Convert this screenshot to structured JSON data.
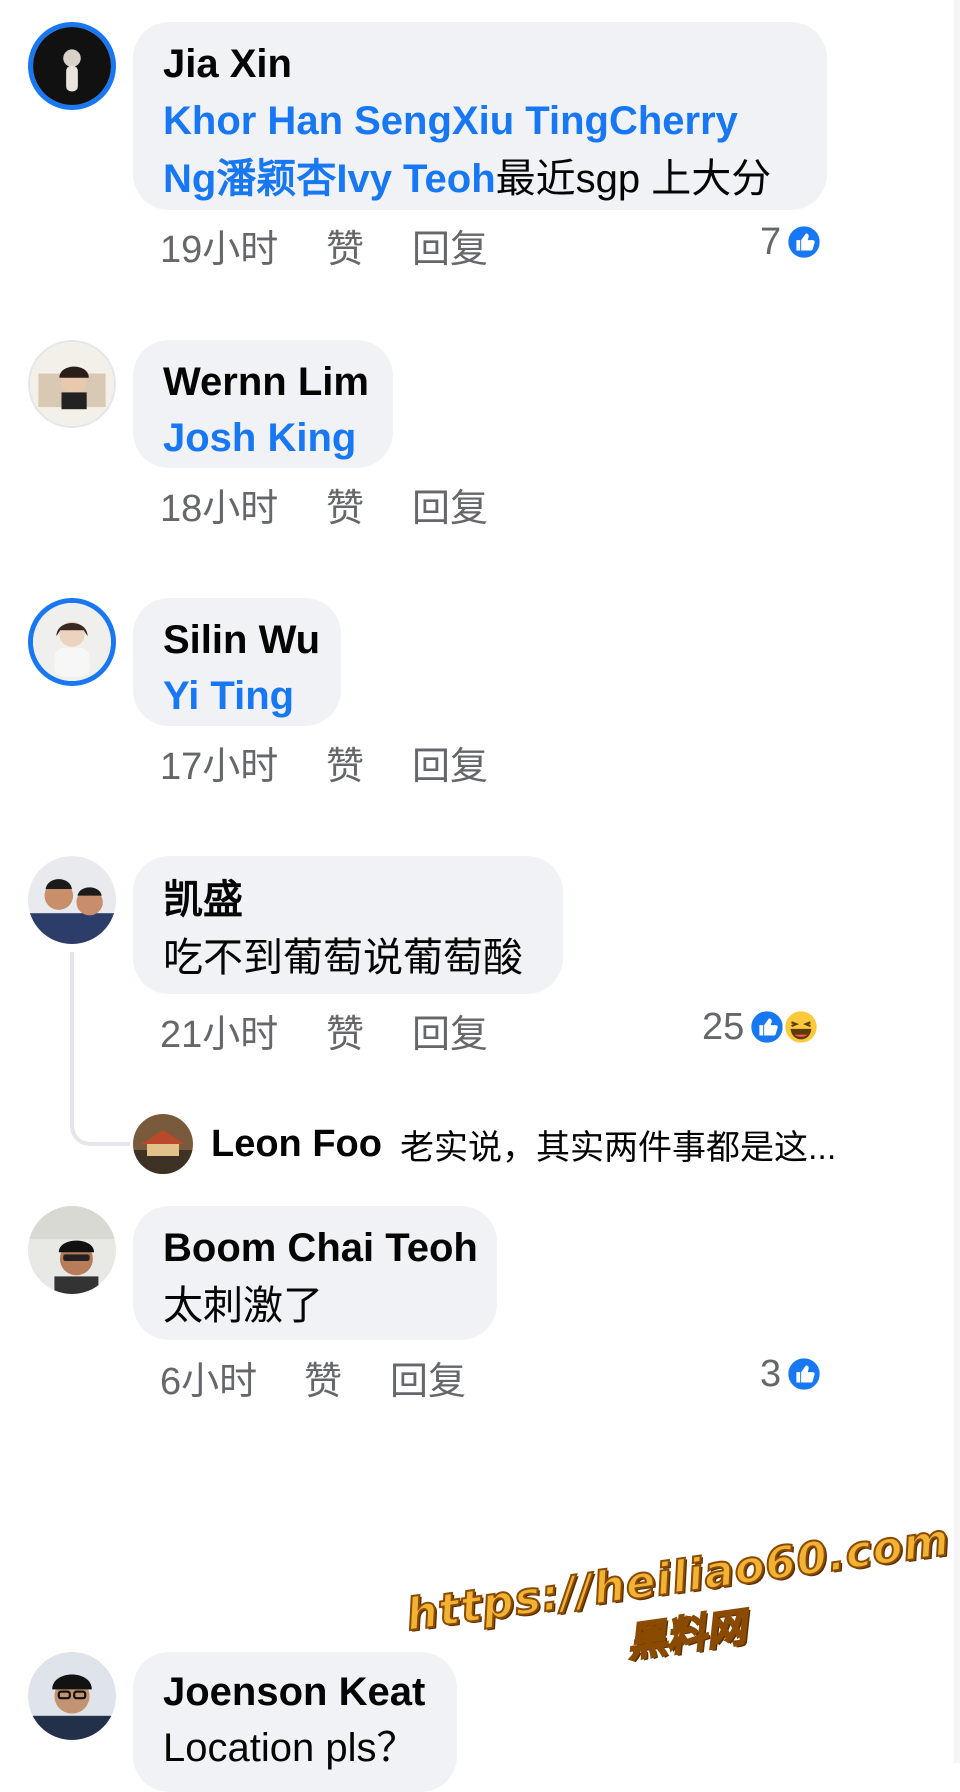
{
  "accent": "#1877f2",
  "comments": [
    {
      "author": "Jia Xin",
      "mentions": [
        "Khor Han Seng",
        "Xiu Ting",
        "Cherry Ng",
        "潘颖杏",
        "Ivy Teoh"
      ],
      "text": "最近sgp 上大分",
      "time": "19小时",
      "like": "赞",
      "reply": "回复",
      "reaction_count": "7"
    },
    {
      "author": "Wernn Lim",
      "mentions": [
        "Josh King"
      ],
      "time": "18小时",
      "like": "赞",
      "reply": "回复"
    },
    {
      "author": "Silin Wu",
      "mentions": [
        "Yi Ting"
      ],
      "time": "17小时",
      "like": "赞",
      "reply": "回复"
    },
    {
      "author": "凯盛",
      "text": "吃不到葡萄说葡萄酸",
      "time": "21小时",
      "like": "赞",
      "reply": "回复",
      "reaction_count": "25",
      "reply_preview": {
        "author": "Leon Foo",
        "text": "老实说，其实两件事都是这..."
      }
    },
    {
      "author": "Boom Chai Teoh",
      "text": "太刺激了",
      "time": "6小时",
      "like": "赞",
      "reply": "回复",
      "reaction_count": "3"
    },
    {
      "author": "Joenson Keat",
      "text": "Location pls？"
    }
  ],
  "watermark": {
    "line1": "https://heiliao60.com",
    "line2": "黑料网"
  }
}
